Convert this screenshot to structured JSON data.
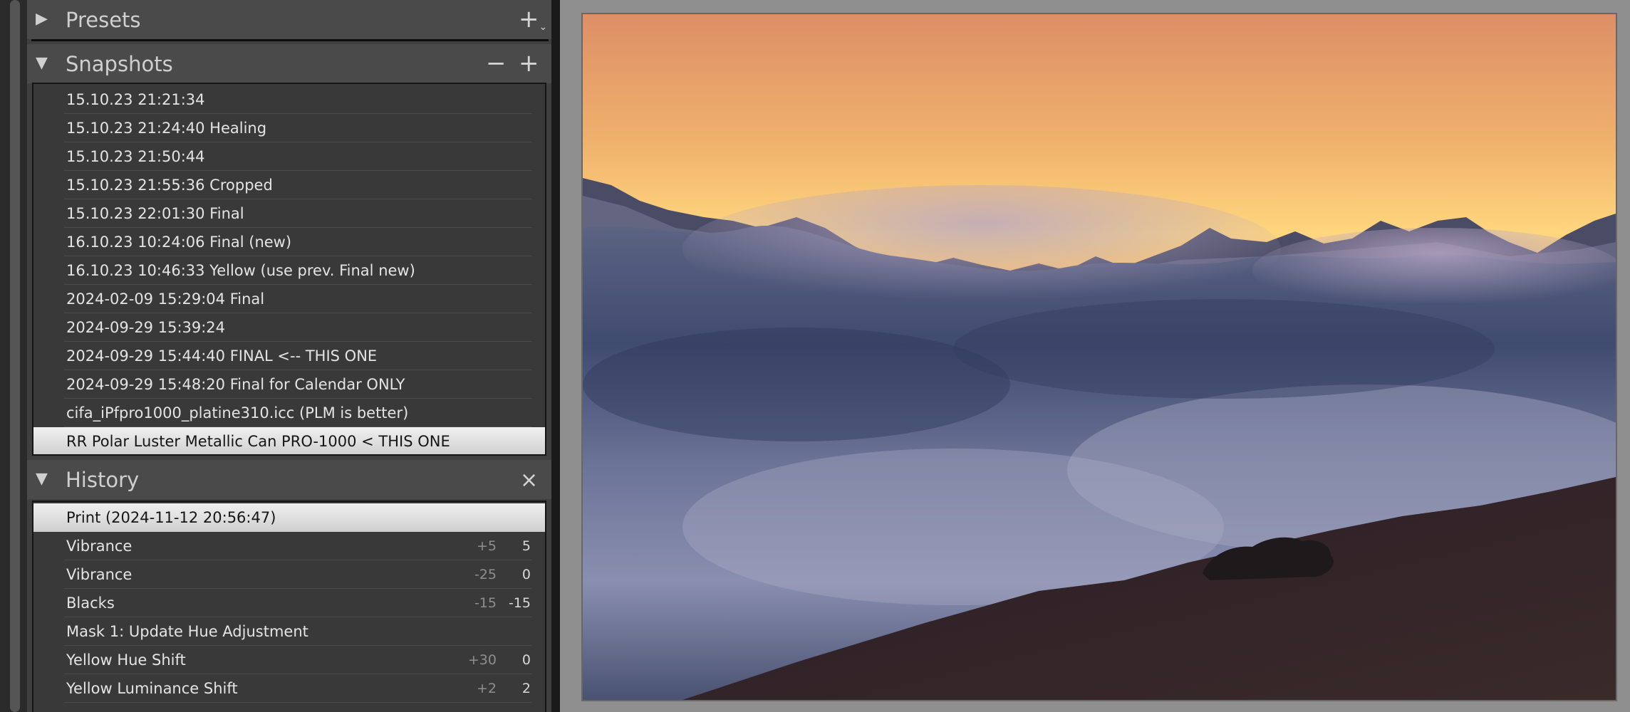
{
  "presets": {
    "title": "Presets",
    "add_icon": "+"
  },
  "snapshots": {
    "title": "Snapshots",
    "remove_icon": "−",
    "add_icon": "+",
    "items": [
      "15.10.23 21:21:34",
      "15.10.23 21:24:40 Healing",
      "15.10.23 21:50:44",
      "15.10.23 21:55:36 Cropped",
      "15.10.23 22:01:30 Final",
      "16.10.23 10:24:06 Final (new)",
      "16.10.23 10:46:33 Yellow (use prev. Final new)",
      "2024-02-09 15:29:04 Final",
      "2024-09-29 15:39:24",
      "2024-09-29 15:44:40 FINAL <-- THIS ONE",
      "2024-09-29 15:48:20 Final for Calendar ONLY",
      "cifa_iPfpro1000_platine310.icc (PLM is better)",
      "RR Polar Luster Metallic Can PRO-1000 < THIS ONE"
    ],
    "selected_index": 12
  },
  "history": {
    "title": "History",
    "clear_icon": "×",
    "items": [
      {
        "label": "Print (2024-11-12 20:56:47)",
        "from": "",
        "to": ""
      },
      {
        "label": "Vibrance",
        "from": "+5",
        "to": "5"
      },
      {
        "label": "Vibrance",
        "from": "-25",
        "to": "0"
      },
      {
        "label": "Blacks",
        "from": "-15",
        "to": "-15"
      },
      {
        "label": "Mask 1: Update Hue Adjustment",
        "from": "",
        "to": ""
      },
      {
        "label": "Yellow Hue Shift",
        "from": "+30",
        "to": "0"
      },
      {
        "label": "Yellow Luminance Shift",
        "from": "+2",
        "to": "2"
      }
    ],
    "selected_index": 0
  },
  "colors": {
    "panel_bg": "#3f3f3f",
    "header_bg": "#4a4a4a",
    "selection": "#dcdcdc",
    "image_surround": "#8f8f8f"
  }
}
